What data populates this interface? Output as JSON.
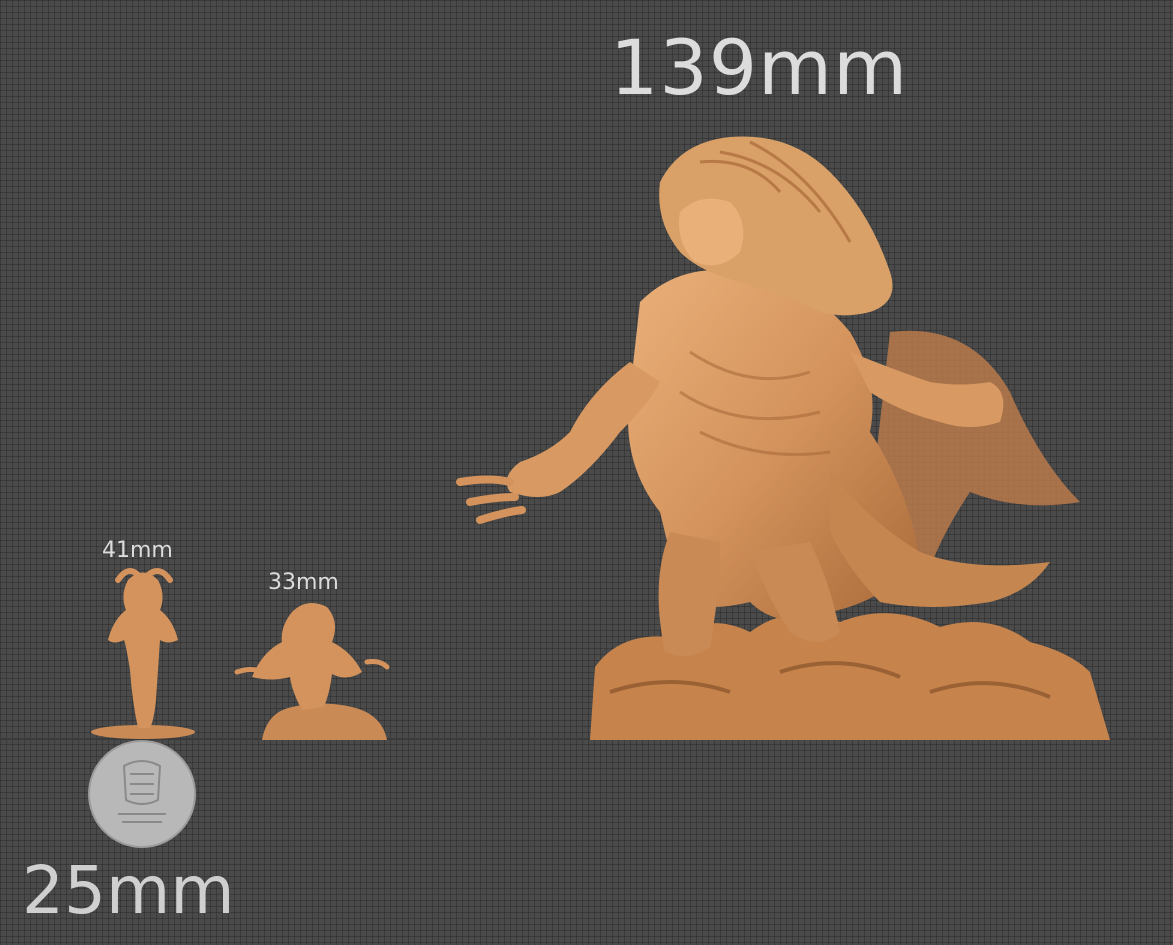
{
  "labels": {
    "large_height": "139mm",
    "small_a_height": "41mm",
    "small_b_height": "33mm",
    "base_size": "25mm"
  },
  "colors": {
    "background": "#4a4a4a",
    "model": "#d4935c",
    "model_shadow": "#a86a3a",
    "model_highlight": "#eab07a",
    "base_disc": "#b8b8b8",
    "label_text": "#dcdcdc"
  },
  "icons": {
    "base_logo": "logo-icon"
  }
}
